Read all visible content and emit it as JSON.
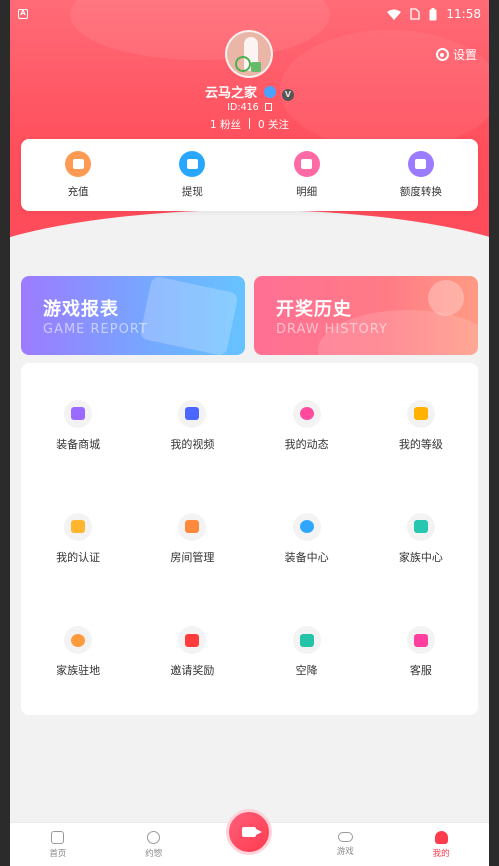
{
  "status_bar": {
    "time": "11:58",
    "left_icon": "A"
  },
  "header": {
    "settings_label": "设置"
  },
  "profile": {
    "name": "云马之家",
    "id_text": "ID:416",
    "fans": "1 粉丝",
    "following": "0 关注"
  },
  "wallet": {
    "items": [
      {
        "label": "充值",
        "icon": "recharge-icon",
        "color": "#ff9a52"
      },
      {
        "label": "提现",
        "icon": "withdraw-icon",
        "color": "#29a6ff"
      },
      {
        "label": "明细",
        "icon": "details-icon",
        "color": "#ff6aa5"
      },
      {
        "label": "额度转换",
        "icon": "quota-transfer-icon",
        "color": "#9b7bff"
      }
    ]
  },
  "banners": {
    "game": {
      "title": "游戏报表",
      "subtitle": "GAME REPORT"
    },
    "draw": {
      "title": "开奖历史",
      "subtitle": "DRAW HISTORY"
    }
  },
  "grid": {
    "items": [
      {
        "label": "装备商城",
        "icon": "store-icon",
        "color": "#9b6bff"
      },
      {
        "label": "我的视频",
        "icon": "video-icon",
        "color": "#4a66ff"
      },
      {
        "label": "我的动态",
        "icon": "moments-icon",
        "color": "#ff4a9e"
      },
      {
        "label": "我的等级",
        "icon": "crown-icon",
        "color": "#ffb300"
      },
      {
        "label": "我的认证",
        "icon": "certificate-icon",
        "color": "#ffb52e"
      },
      {
        "label": "房间管理",
        "icon": "room-icon",
        "color": "#ff8a3d"
      },
      {
        "label": "装备中心",
        "icon": "bulb-icon",
        "color": "#2fa7ff"
      },
      {
        "label": "家族中心",
        "icon": "family-icon",
        "color": "#26c6b0"
      },
      {
        "label": "家族驻地",
        "icon": "location-icon",
        "color": "#ff9a3d"
      },
      {
        "label": "邀请奖励",
        "icon": "heart-icon",
        "color": "#ff3b3b"
      },
      {
        "label": "空降",
        "icon": "airplane-icon",
        "color": "#22c3a6"
      },
      {
        "label": "客服",
        "icon": "customer-service-icon",
        "color": "#ff3e9e"
      }
    ]
  },
  "tabbar": {
    "items": [
      {
        "label": "首页",
        "icon": "home-icon"
      },
      {
        "label": "约惣",
        "icon": "date-icon"
      },
      {
        "label": "",
        "icon": "camera-icon"
      },
      {
        "label": "游戏",
        "icon": "game-icon"
      },
      {
        "label": "我的",
        "icon": "profile-icon"
      }
    ]
  }
}
